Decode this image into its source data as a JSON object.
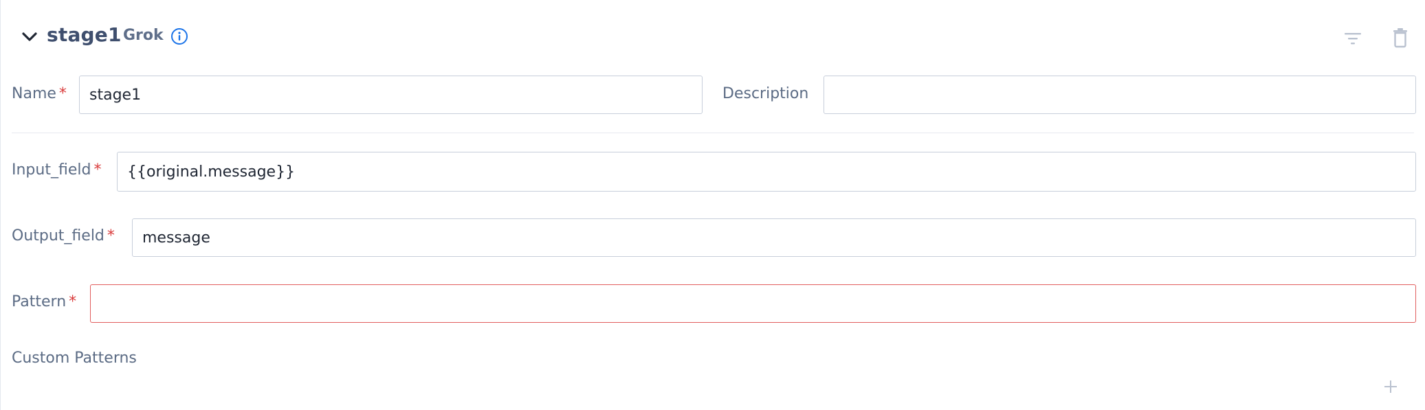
{
  "header": {
    "stage_name": "stage1",
    "stage_type": "Grok",
    "icons": {
      "collapse": "chevron-down-icon",
      "info": "info-icon",
      "filter": "filter-icon",
      "delete": "trash-icon"
    }
  },
  "form": {
    "name": {
      "label": "Name",
      "required_mark": "*",
      "value": "stage1"
    },
    "description": {
      "label": "Description",
      "value": ""
    },
    "input_field": {
      "label": "Input_field",
      "required_mark": "*",
      "value": "{{original.message}}"
    },
    "output_field": {
      "label": "Output_field",
      "required_mark": "*",
      "value": "message"
    },
    "pattern": {
      "label": "Pattern",
      "required_mark": "*",
      "value": ""
    },
    "custom_patterns": {
      "label": "Custom Patterns",
      "add_icon": "plus-icon"
    }
  },
  "colors": {
    "accent": "#1a73e8",
    "title": "#3f4f6e",
    "label": "#5b6b84",
    "required": "#d93b3b",
    "error_border": "#e15c5c",
    "muted_icon": "#b9c1cf"
  }
}
